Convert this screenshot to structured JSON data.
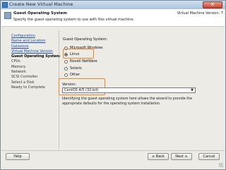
{
  "window": {
    "title": "Create New Virtual Machine",
    "close_label": "✕"
  },
  "header": {
    "title": "Guest Operating System",
    "subtitle": "Specify the guest operating system to use with this virtual machine.",
    "version": "Virtual Machine Version: 7"
  },
  "steps": [
    {
      "label": "Configuration",
      "state": "link"
    },
    {
      "label": "Name and Location",
      "state": "link"
    },
    {
      "label": "Datastore",
      "state": "link"
    },
    {
      "label": "Virtual Machine Version",
      "state": "link"
    },
    {
      "label": "Guest Operating System",
      "state": "current"
    },
    {
      "label": "CPUs",
      "state": "pending"
    },
    {
      "label": "Memory",
      "state": "pending"
    },
    {
      "label": "Network",
      "state": "pending"
    },
    {
      "label": "SCSI Controller",
      "state": "pending"
    },
    {
      "label": "Select a Disk",
      "state": "pending"
    },
    {
      "label": "Ready to Complete",
      "state": "pending"
    }
  ],
  "guest_os": {
    "label": "Guest Operating System:",
    "options": [
      {
        "label": "Microsoft Windows",
        "selected": false
      },
      {
        "label": "Linux",
        "selected": true
      },
      {
        "label": "Novell NetWare",
        "selected": false
      },
      {
        "label": "Solaris",
        "selected": false
      },
      {
        "label": "Other",
        "selected": false
      }
    ]
  },
  "version": {
    "label": "Version:",
    "value": "CentOS 4/5 (32-bit)",
    "description": "Identifying the guest operating system here allows the wizard to provide the appropriate defaults for the operating system installation."
  },
  "footer": {
    "help": "Help",
    "back": "≤ Back",
    "next": "Next ≥",
    "cancel": "Cancel"
  },
  "colors": {
    "highlight": "#f58220",
    "link": "#1f4fb8"
  }
}
